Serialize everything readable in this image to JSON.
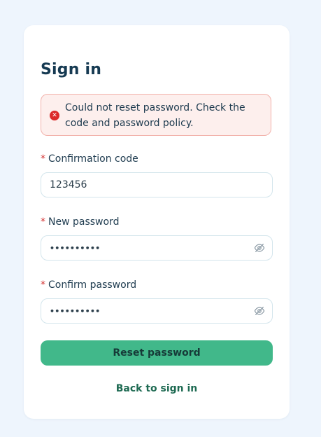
{
  "page": {
    "title": "Sign in"
  },
  "alert": {
    "icon": "error-circle-icon",
    "message": "Could not reset password. Check the code and password policy."
  },
  "form": {
    "required_marker": "*",
    "confirmation_code": {
      "label": "Confirmation code",
      "value": "123456"
    },
    "new_password": {
      "label": "New password",
      "value": "••••••••••",
      "toggle_icon": "eye-off-icon"
    },
    "confirm_password": {
      "label": "Confirm password",
      "value": "••••••••••",
      "toggle_icon": "eye-off-icon"
    },
    "submit_label": "Reset password",
    "back_link": "Back to sign in"
  },
  "colors": {
    "background": "#eef5fd",
    "primary": "#41b88a",
    "error": "#dc2b2b",
    "title": "#163a52"
  }
}
